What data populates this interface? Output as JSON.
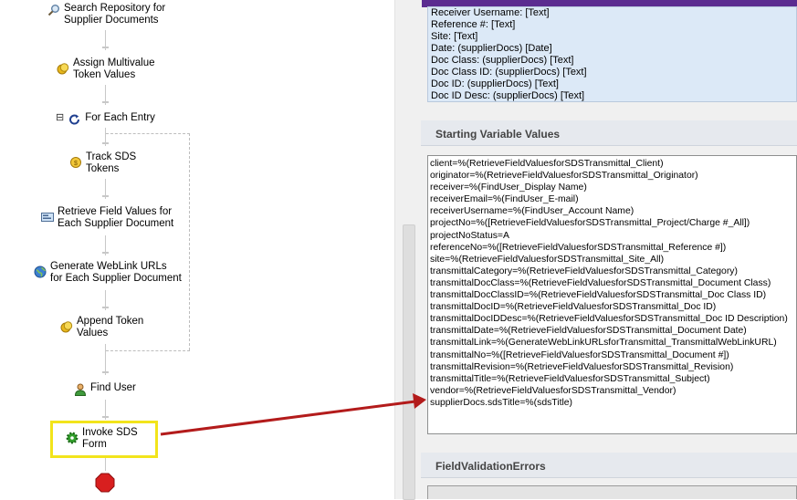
{
  "workflow": {
    "steps": [
      {
        "label": "Search Repository for\nSupplier Documents",
        "icon": "search-icon"
      },
      {
        "label": "Assign Multivalue\nToken Values",
        "icon": "token-coin-icon"
      },
      {
        "label": "For Each Entry",
        "icon": "loop-icon",
        "collapse": "⊟"
      },
      {
        "label": "Track SDS\nTokens",
        "icon": "token-coin-icon"
      },
      {
        "label": "Retrieve Field Values for\nEach Supplier Document",
        "icon": "field-values-icon"
      },
      {
        "label": "Generate WebLink URLs\nfor Each Supplier Document",
        "icon": "weblink-globe-icon"
      },
      {
        "label": "Append Token\nValues",
        "icon": "token-coin-icon"
      },
      {
        "label": "Find User",
        "icon": "user-icon"
      },
      {
        "label": "Invoke SDS\nForm",
        "icon": "gear-icon"
      }
    ],
    "end_icon": "stop-icon"
  },
  "properties": {
    "field_list": [
      "Receiver Username: [Text]",
      "Reference #: [Text]",
      "Site: [Text]",
      "Date: (supplierDocs) [Date]",
      "Doc Class: (supplierDocs) [Text]",
      "Doc Class ID: (supplierDocs) [Text]",
      "Doc ID: (supplierDocs) [Text]",
      "Doc ID Desc: (supplierDocs) [Text]"
    ],
    "starting_variables_title": "Starting Variable Values",
    "starting_variables": [
      "client=%(RetrieveFieldValuesforSDSTransmittal_Client)",
      "originator=%(RetrieveFieldValuesforSDSTransmittal_Originator)",
      "receiver=%(FindUser_Display Name)",
      "receiverEmail=%(FindUser_E-mail)",
      "receiverUsername=%(FindUser_Account Name)",
      "projectNo=%([RetrieveFieldValuesforSDSTransmittal_Project/Charge #_All])",
      "projectNoStatus=A",
      "referenceNo=%([RetrieveFieldValuesforSDSTransmittal_Reference #])",
      "site=%(RetrieveFieldValuesforSDSTransmittal_Site_All)",
      "transmittalCategory=%(RetrieveFieldValuesforSDSTransmittal_Category)",
      "transmittalDocClass=%(RetrieveFieldValuesforSDSTransmittal_Document Class)",
      "transmittalDocClassID=%(RetrieveFieldValuesforSDSTransmittal_Doc Class ID)",
      "transmittalDocID=%(RetrieveFieldValuesforSDSTransmittal_Doc ID)",
      "transmittalDocIDDesc=%(RetrieveFieldValuesforSDSTransmittal_Doc ID Description)",
      "transmittalDate=%(RetrieveFieldValuesforSDSTransmittal_Document Date)",
      "transmittalLink=%(GenerateWebLinkURLsforTransmittal_TransmittalWebLinkURL)",
      "transmittalNo=%([RetrieveFieldValuesforSDSTransmittal_Document #])",
      "transmittalRevision=%(RetrieveFieldValuesforSDSTransmittal_Revision)",
      "transmittalTitle=%(RetrieveFieldValuesforSDSTransmittal_Subject)",
      "vendor=%(RetrieveFieldValuesforSDSTransmittal_Vendor)",
      "supplierDocs.sdsTitle=%(sdsTitle)"
    ],
    "field_validation_title": "FieldValidationErrors"
  },
  "colors": {
    "highlight": "#f2e41b",
    "arrow": "#b31b1b",
    "form_header": "#5b2c90",
    "field_box": "#dce9f7"
  }
}
